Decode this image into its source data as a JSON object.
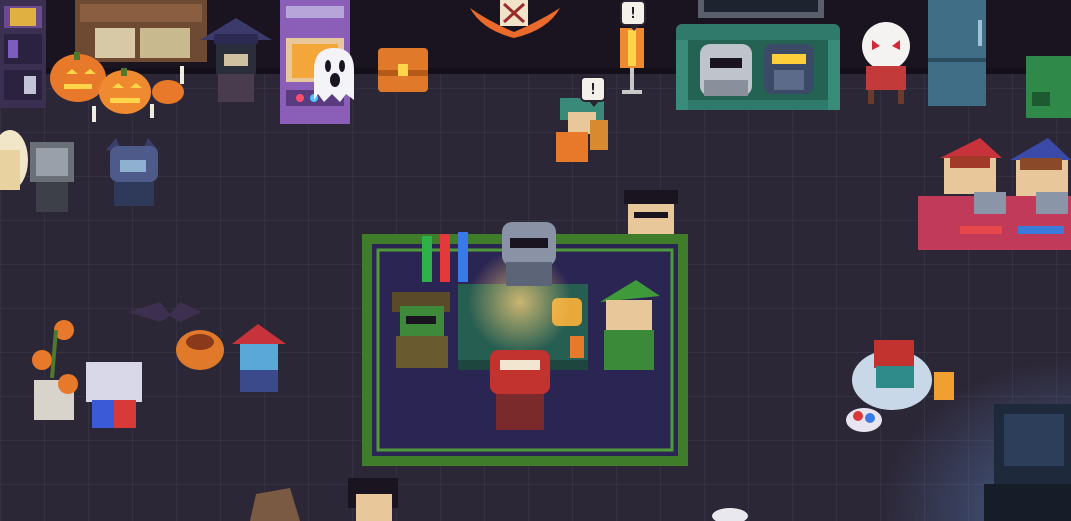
{
  "scene": {
    "description_free": true,
    "alert_bubble_1": "!",
    "alert_bubble_2": "!"
  },
  "colors": {
    "floor": "#2c2737",
    "floor_line": "#3a3446",
    "back_wall": "#1a1420",
    "rug_border": "#3f7d2b",
    "rug_inner": "#2b2553",
    "table": "#275e52",
    "pumpkin": "#e8792a",
    "couch": "#2f7a6a",
    "arcade": "#8b5fb8"
  }
}
